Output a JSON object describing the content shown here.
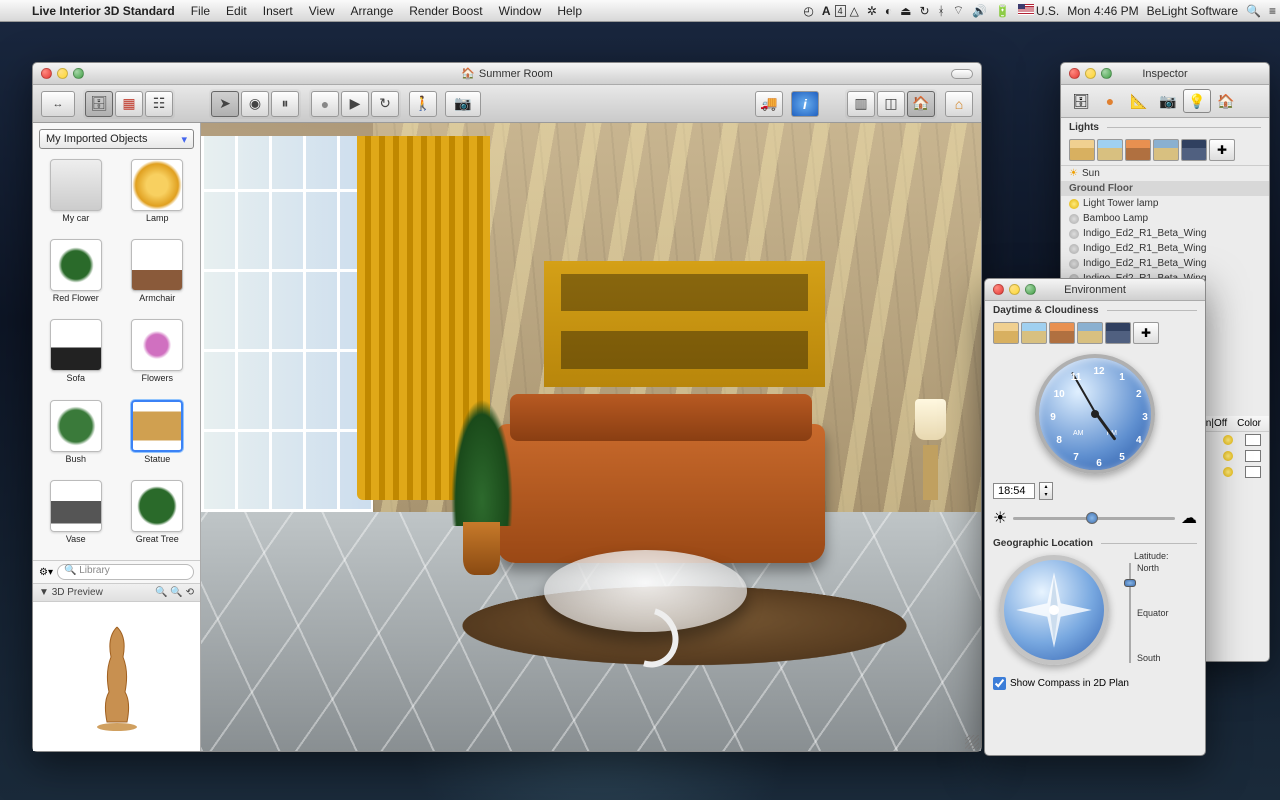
{
  "menubar": {
    "apple": "",
    "app": "Live Interior 3D Standard",
    "items": [
      "File",
      "Edit",
      "Insert",
      "View",
      "Arrange",
      "Render Boost",
      "Window",
      "Help"
    ],
    "locale": "U.S.",
    "clock": "Mon 4:46 PM",
    "company": "BeLight Software"
  },
  "main_window": {
    "title": "Summer Room",
    "library_selector": "My Imported Objects",
    "library_search_placeholder": "Library",
    "items": [
      {
        "label": "My car",
        "thumb": "th-car"
      },
      {
        "label": "Lamp",
        "thumb": "th-lamp"
      },
      {
        "label": "Red Flower",
        "thumb": "th-plant"
      },
      {
        "label": "Armchair",
        "thumb": "th-chair"
      },
      {
        "label": "Sofa",
        "thumb": "th-sofa"
      },
      {
        "label": "Flowers",
        "thumb": "th-flower"
      },
      {
        "label": "Bush",
        "thumb": "th-bush"
      },
      {
        "label": "Statue",
        "thumb": "th-statue",
        "selected": true
      },
      {
        "label": "Vase",
        "thumb": "th-vase"
      },
      {
        "label": "Great Tree",
        "thumb": "th-tree"
      }
    ],
    "preview_label": "3D Preview"
  },
  "inspector": {
    "title": "Inspector",
    "lights_label": "Lights",
    "sun_label": "Sun",
    "group_label": "Ground Floor",
    "lights": [
      "Light Tower lamp",
      "Bamboo Lamp",
      "Indigo_Ed2_R1_Beta_Wing",
      "Indigo_Ed2_R1_Beta_Wing",
      "Indigo_Ed2_R1_Beta_Wing",
      "Indigo_Ed2_R1_Beta_Wing"
    ],
    "col_onoff": "On|Off",
    "col_color": "Color"
  },
  "environment": {
    "title": "Environment",
    "section1": "Daytime & Cloudiness",
    "time_value": "18:54",
    "am_label": "AM",
    "pm_label": "PM",
    "clock_numbers": [
      "12",
      "1",
      "2",
      "3",
      "4",
      "5",
      "6",
      "7",
      "8",
      "9",
      "10",
      "11"
    ],
    "section2": "Geographic Location",
    "lat_label": "Latitude:",
    "lat_north": "North",
    "lat_eq": "Equator",
    "lat_south": "South",
    "compass_check": "Show Compass in 2D Plan"
  }
}
